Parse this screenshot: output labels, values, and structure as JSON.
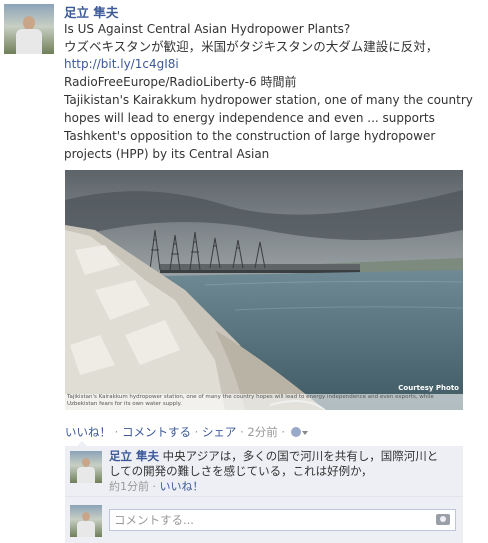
{
  "post": {
    "author": "足立 隼夫",
    "message_line1": "Is US Against Central Asian Hydropower Plants?",
    "message_line2": "ウズベキスタンが歓迎，米国がタジキスタンの大ダム建設に反対，",
    "link": "http://bit.ly/1c4gI8i",
    "source_and_time": "RadioFreeEurope/RadioLiberty-6 時間前",
    "description": "Tajikistan's Kairakkum hydropower station, one of many the country hopes will lead to energy independence and even ... supports Tashkent's opposition to the construction of large hydropower projects (HPP) by its Central Asian",
    "photo_caption": "Tajikistan's Kairakkum hydropower station, one of many the country hopes will lead to energy independence and even exports, while Uzbekistan fears for its own water supply.",
    "photo_credit": "Courtesy Photo"
  },
  "actions": {
    "like": "いいね！",
    "separator": " · ",
    "comment": "コメントする",
    "share": "シェア",
    "time": "2分前",
    "audience_icon": "globe-icon"
  },
  "comment": {
    "author": "足立 隼夫",
    "text": "中央アジアは，多くの国で河川を共有し，国際河川としての開発の難しさを感じている，これは好例か，",
    "time": "約1分前",
    "like": "いいね！"
  },
  "compose": {
    "placeholder": "コメントする...",
    "camera_icon": "camera-icon"
  },
  "colors": {
    "link": "#3b5998",
    "muted": "#999999",
    "comment_bg": "#edeff4"
  }
}
